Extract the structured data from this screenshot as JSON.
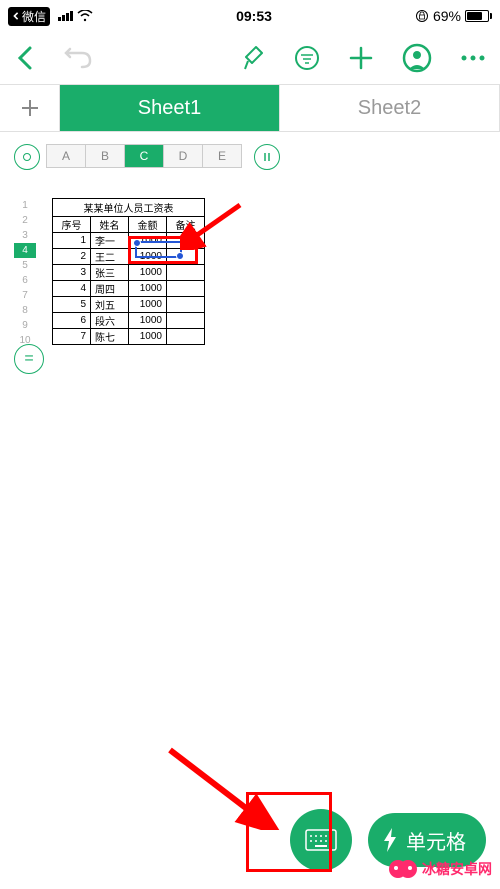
{
  "status_bar": {
    "back_app": "微信",
    "time": "09:53",
    "battery_pct": "69%"
  },
  "tabs": {
    "sheet1": "Sheet1",
    "sheet2": "Sheet2"
  },
  "columns": [
    "A",
    "B",
    "C",
    "D",
    "E"
  ],
  "rows": [
    "1",
    "2",
    "3",
    "4",
    "5",
    "6",
    "7",
    "8",
    "9",
    "10"
  ],
  "selected_col": "C",
  "selected_row": "4",
  "table": {
    "title": "某某单位人员工资表",
    "headers": [
      "序号",
      "姓名",
      "金额",
      "备注"
    ],
    "rows": [
      {
        "no": "1",
        "name": "李一",
        "amount": "1000",
        "note": ""
      },
      {
        "no": "2",
        "name": "王二",
        "amount": "1000",
        "note": ""
      },
      {
        "no": "3",
        "name": "张三",
        "amount": "1000",
        "note": ""
      },
      {
        "no": "4",
        "name": "周四",
        "amount": "1000",
        "note": ""
      },
      {
        "no": "5",
        "name": "刘五",
        "amount": "1000",
        "note": ""
      },
      {
        "no": "6",
        "name": "段六",
        "amount": "1000",
        "note": ""
      },
      {
        "no": "7",
        "name": "陈七",
        "amount": "1000",
        "note": ""
      }
    ]
  },
  "selected_cell_value": "1000",
  "bottom": {
    "cell_label": "单元格"
  },
  "watermark": "冰糖安卓网",
  "colors": {
    "accent": "#1aad6a",
    "annotation": "#ff0000",
    "selection": "#2456d6"
  }
}
